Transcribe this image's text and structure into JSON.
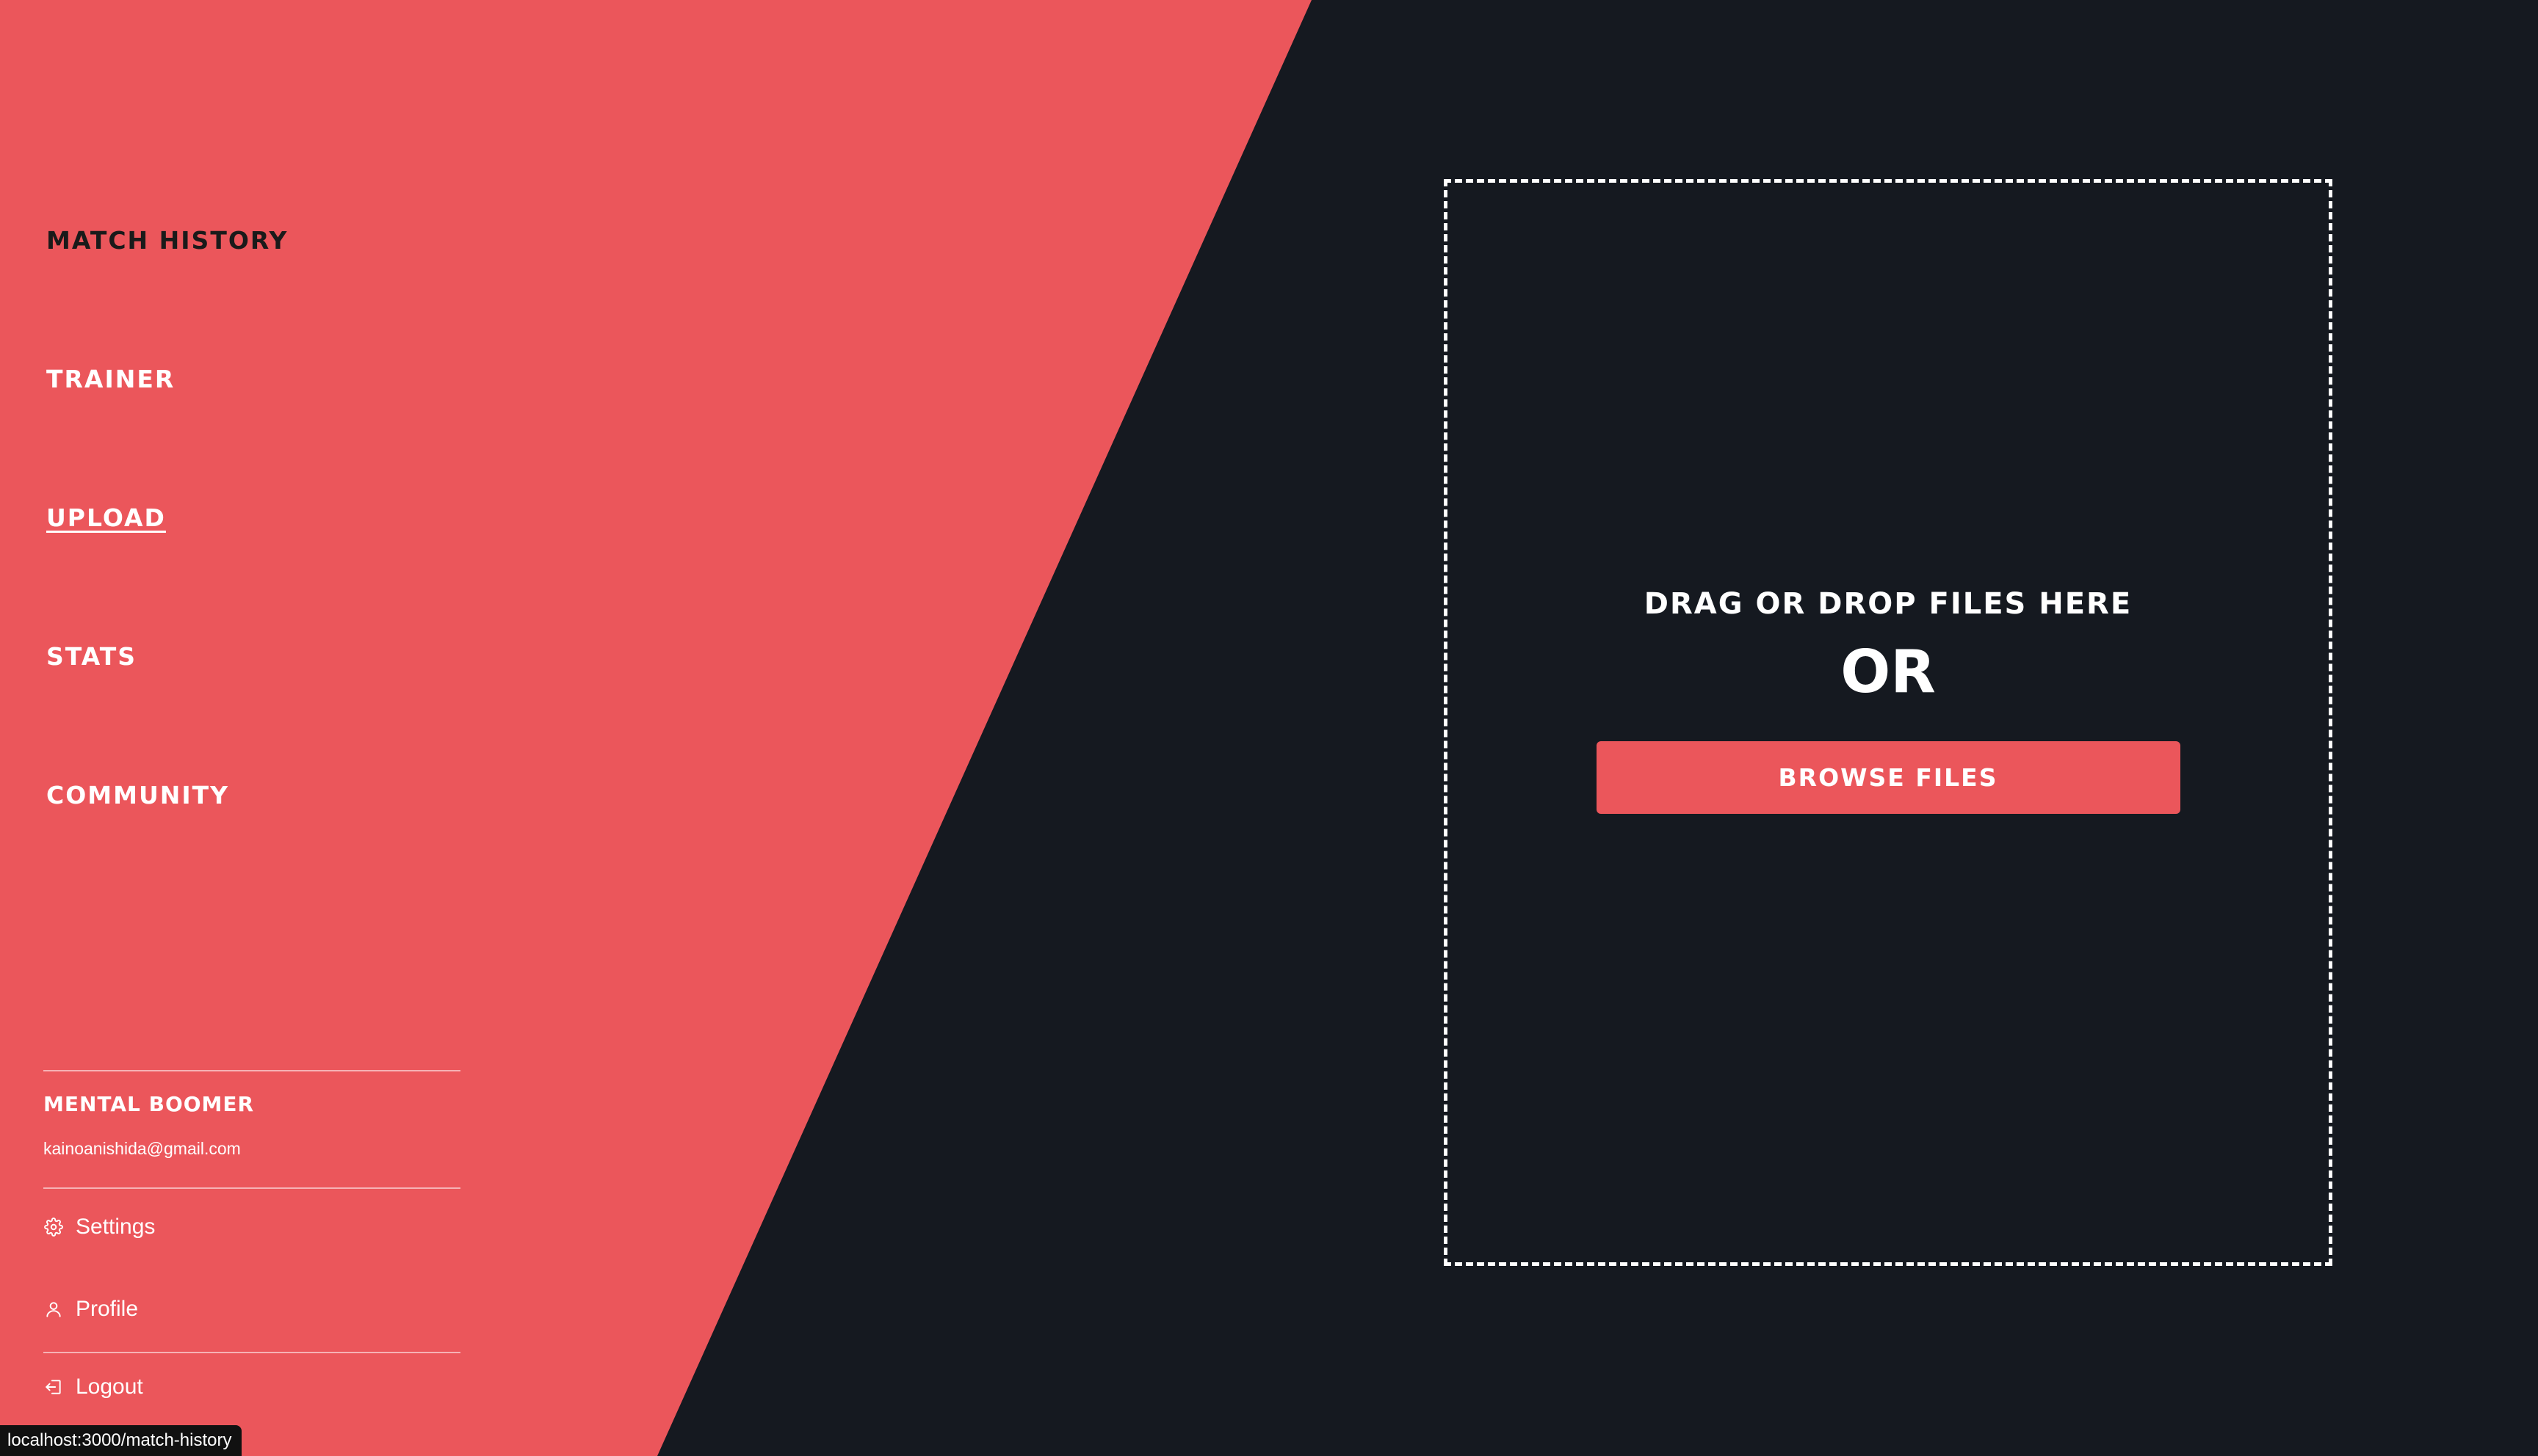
{
  "colors": {
    "accent": "#eb565b",
    "background": "#151920",
    "text": "#ffffff",
    "nav_dark_text": "#1a1a1a"
  },
  "nav": {
    "items": [
      {
        "label": "MATCH HISTORY",
        "active": false
      },
      {
        "label": "TRAINER",
        "active": false
      },
      {
        "label": "UPLOAD",
        "active": true
      },
      {
        "label": "STATS",
        "active": false
      },
      {
        "label": "COMMUNITY",
        "active": false
      }
    ]
  },
  "user": {
    "name": "MENTAL BOOMER",
    "email": "kainoanishida@gmail.com"
  },
  "menu": {
    "settings_label": "Settings",
    "settings_icon": "gear-icon",
    "profile_label": "Profile",
    "profile_icon": "user-icon",
    "logout_label": "Logout",
    "logout_icon": "logout-icon"
  },
  "upload": {
    "heading": "DRAG OR DROP FILES HERE",
    "or_text": "OR",
    "browse_label": "BROWSE FILES"
  },
  "status_bar": {
    "url": "localhost:3000/match-history"
  }
}
